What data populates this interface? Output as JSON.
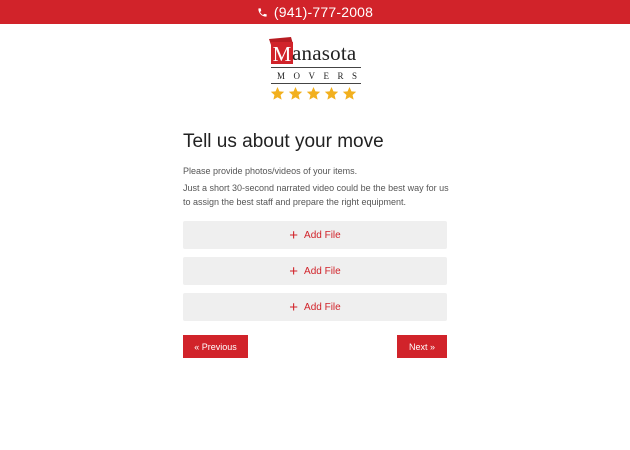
{
  "header": {
    "phone": "(941)-777-2008",
    "phone_icon": "phone-icon",
    "background_color": "#d1232a"
  },
  "logo": {
    "initial": "M",
    "word": "anasota",
    "subtitle": "MOVERS",
    "rating_stars": 5,
    "star_color": "#f2b01e"
  },
  "main": {
    "title": "Tell us about your move",
    "instruction": "Please provide photos/videos of your items.",
    "description": "Just a short 30-second narrated video could be the best way for us to assign the best staff and prepare the right equipment.",
    "upload_slots": [
      {
        "label": "Add File",
        "icon": "plus-icon"
      },
      {
        "label": "Add File",
        "icon": "plus-icon"
      },
      {
        "label": "Add File",
        "icon": "plus-icon"
      }
    ],
    "previous_label": "« Previous",
    "next_label": "Next »",
    "accent_color": "#d1232a"
  }
}
